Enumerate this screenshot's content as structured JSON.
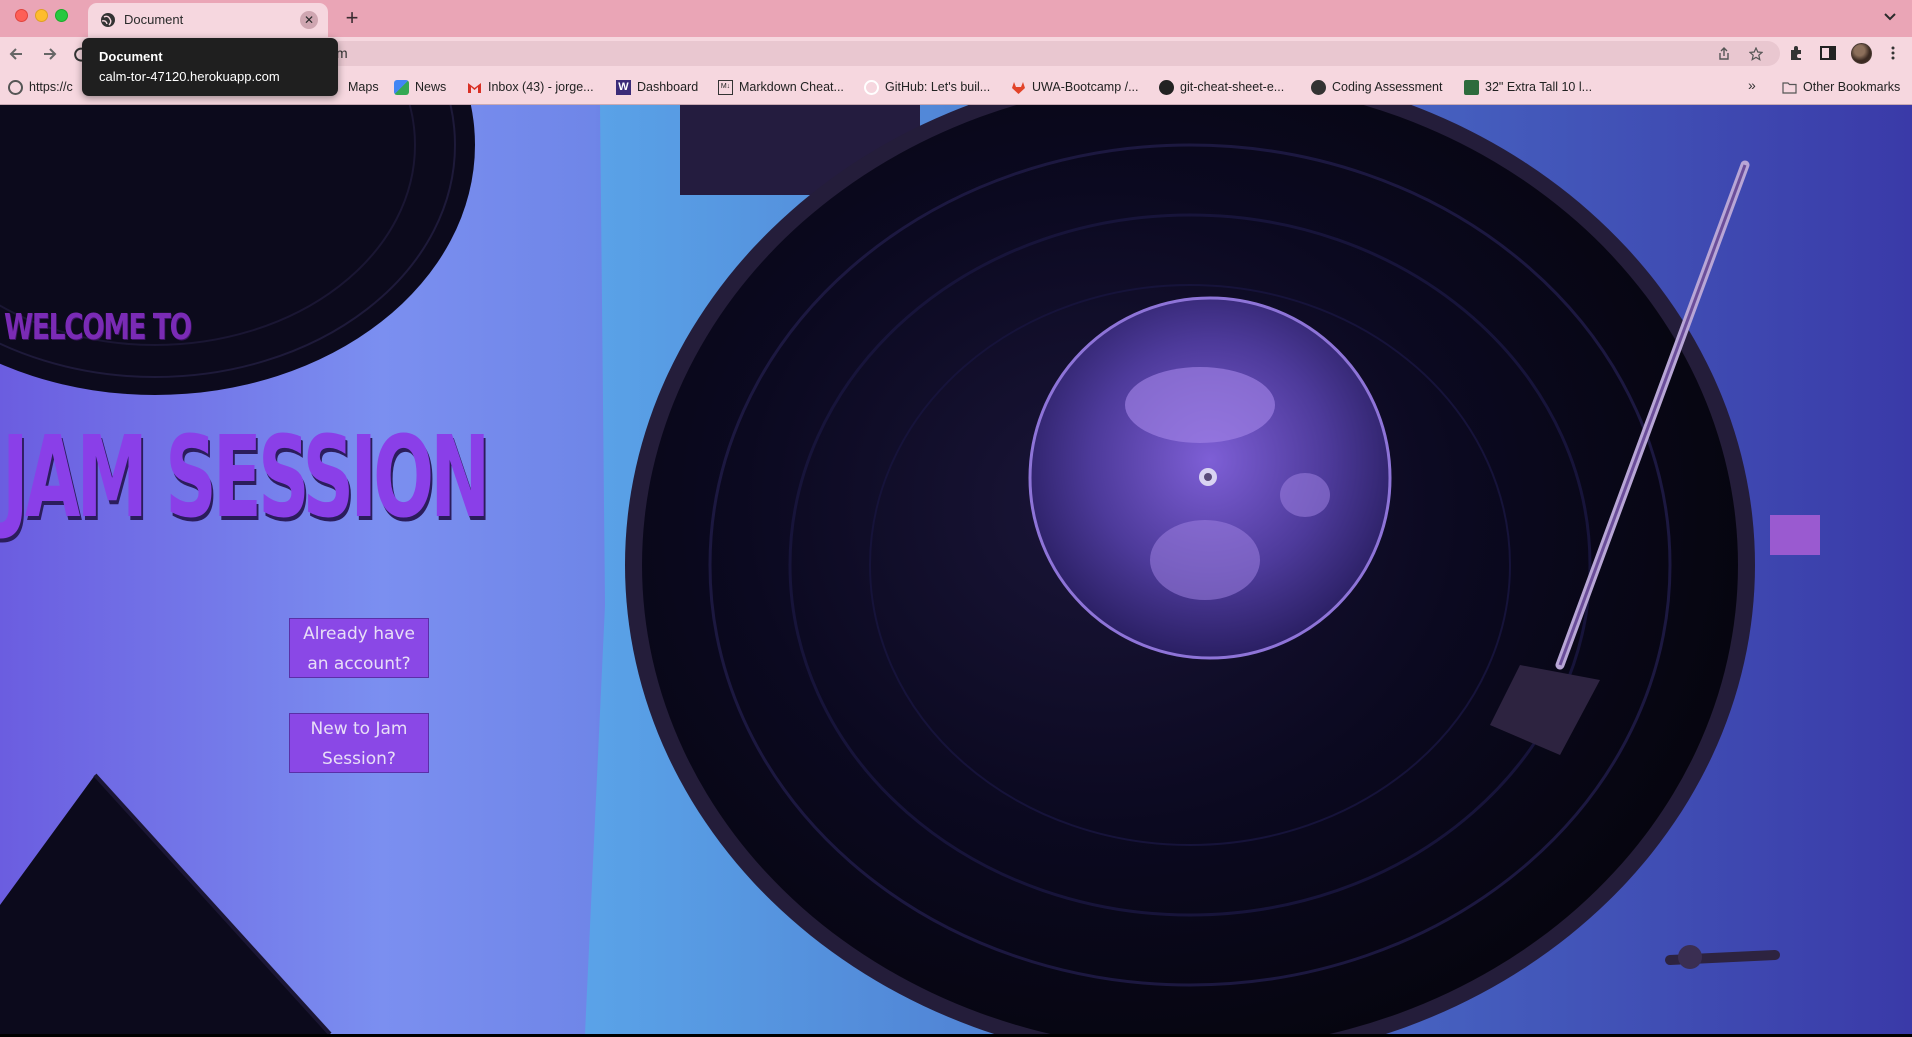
{
  "browser": {
    "tab": {
      "title": "Document"
    },
    "tooltip": {
      "title": "Document",
      "url": "calm-tor-47120.herokuapp.com"
    },
    "omnibox": {
      "visible_text": "m"
    }
  },
  "bookmarks": {
    "items": [
      {
        "label": "https://c",
        "icon": "openai-icon"
      },
      {
        "label": "Maps",
        "icon": "maps-icon"
      },
      {
        "label": "News",
        "icon": "news-icon"
      },
      {
        "label": "Inbox (43) - jorge...",
        "icon": "gmail-icon"
      },
      {
        "label": "Dashboard",
        "icon": "uw-icon"
      },
      {
        "label": "Markdown Cheat...",
        "icon": "markdown-icon"
      },
      {
        "label": "GitHub: Let's buil...",
        "icon": "github-icon"
      },
      {
        "label": "UWA-Bootcamp /...",
        "icon": "gitlab-icon"
      },
      {
        "label": "git-cheat-sheet-e...",
        "icon": "github-icon"
      },
      {
        "label": "Coding Assessment",
        "icon": "globe-icon"
      },
      {
        "label": "32\" Extra Tall 10 l...",
        "icon": "shop-icon"
      }
    ],
    "more": "»",
    "other": "Other Bookmarks"
  },
  "page": {
    "welcome": "WELCOME TO",
    "title": "JAM SESSION",
    "login_button": "Already have an account?",
    "signup_button": "New to Jam Session?"
  },
  "colors": {
    "tabstrip": "#eaa5b6",
    "toolbar": "#f6d7df",
    "accent_purple": "#8a48e6",
    "title_purple": "#8a3fe8"
  }
}
